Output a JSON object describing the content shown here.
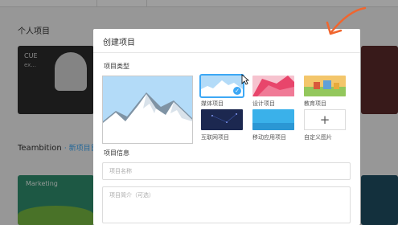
{
  "background": {
    "section_personal_title": "个人项目",
    "card1_title": "CUE",
    "card1_subtitle": "ex...",
    "section_teambition_title": "Teambition",
    "section_teambition_link": "· 新项目首页",
    "card3_title": "Marketing"
  },
  "modal": {
    "title": "创建项目",
    "project_type_label": "项目类型",
    "thumbnails": [
      {
        "label": "媒体项目",
        "selected": true
      },
      {
        "label": "设计项目",
        "selected": false
      },
      {
        "label": "教育项目",
        "selected": false
      },
      {
        "label": "互联网项目",
        "selected": false
      },
      {
        "label": "移动应用项目",
        "selected": false
      },
      {
        "label": "自定义图片",
        "selected": false
      }
    ],
    "add_symbol": "+",
    "project_info_label": "项目信息",
    "name_placeholder": "项目名称",
    "description_placeholder": "项目简介（可选）"
  },
  "colors": {
    "accent": "#3da8f5",
    "annotation_arrow": "#f0662f"
  }
}
